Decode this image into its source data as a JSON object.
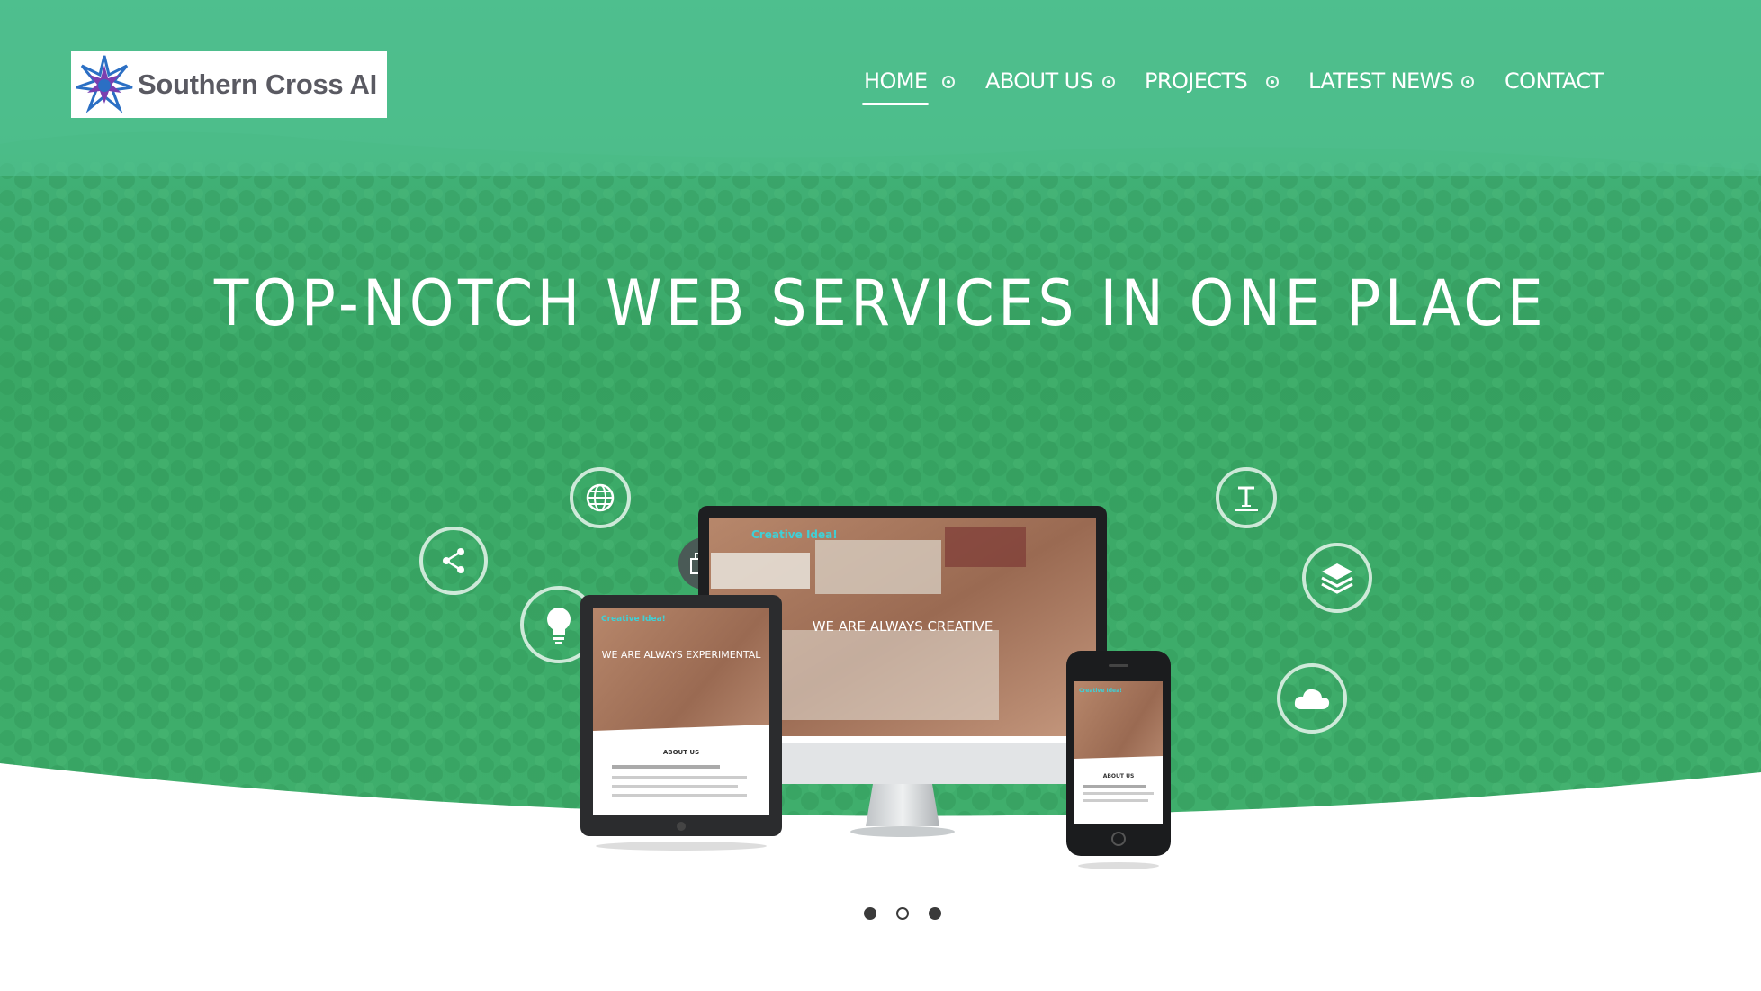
{
  "brand": {
    "name": "Southern Cross AI"
  },
  "nav": {
    "items": [
      {
        "label": "HOME",
        "active": true
      },
      {
        "label": "ABOUT US",
        "active": false
      },
      {
        "label": "PROJECTS",
        "active": false
      },
      {
        "label": "LATEST NEWS",
        "active": false
      },
      {
        "label": "CONTACT",
        "active": false
      }
    ]
  },
  "hero": {
    "headline": "TOP-NOTCH WEB SERVICES IN ONE PLACE",
    "overlay_color": "#3fb27a",
    "icons": [
      "globe-icon",
      "share-icon",
      "lightbulb-icon",
      "devices-icon",
      "text-icon",
      "layers-icon",
      "cloud-icon"
    ]
  },
  "mockup": {
    "desktop": {
      "brand": "Creative Idea!",
      "tagline": "WE ARE ALWAYS CREATIVE"
    },
    "tablet": {
      "brand": "Creative Idea!",
      "tagline": "WE ARE ALWAYS EXPERIMENTAL",
      "section": "ABOUT US"
    },
    "phone": {
      "brand": "Creative Idea!",
      "section": "ABOUT US"
    }
  },
  "slider": {
    "slides": 3,
    "active_index": 1
  },
  "colors": {
    "accent": "#3fb27a",
    "header_tint": "#54c496",
    "text_on_hero": "#ffffff"
  }
}
